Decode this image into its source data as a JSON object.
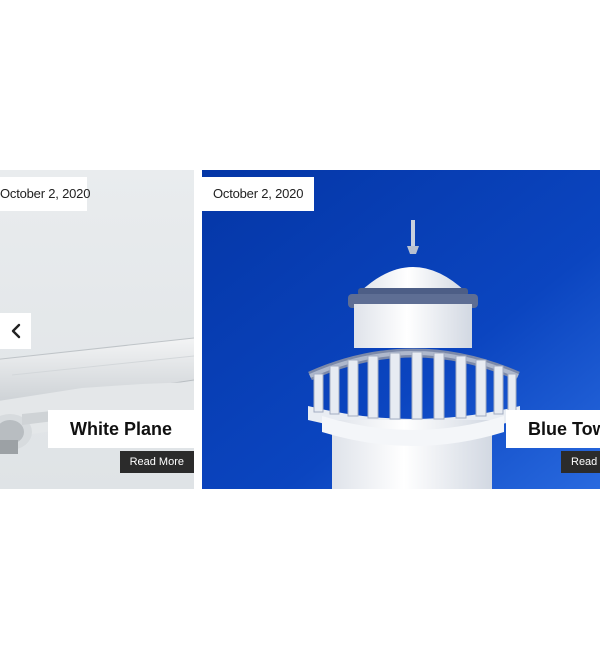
{
  "carousel": {
    "slides": [
      {
        "date": "October 2, 2020",
        "title": "White Plane",
        "read_more": "Read More",
        "image": "white-airplane-wing-photo"
      },
      {
        "date": "October 2, 2020",
        "title": "Blue Tower",
        "read_more": "Read More",
        "image": "white-tower-blue-sky-photo"
      }
    ],
    "prev_icon": "chevron-left-icon"
  },
  "colors": {
    "sky_blue": "#0a3fb0",
    "badge_bg": "#ffffff",
    "button_bg": "#2b2b2b"
  }
}
